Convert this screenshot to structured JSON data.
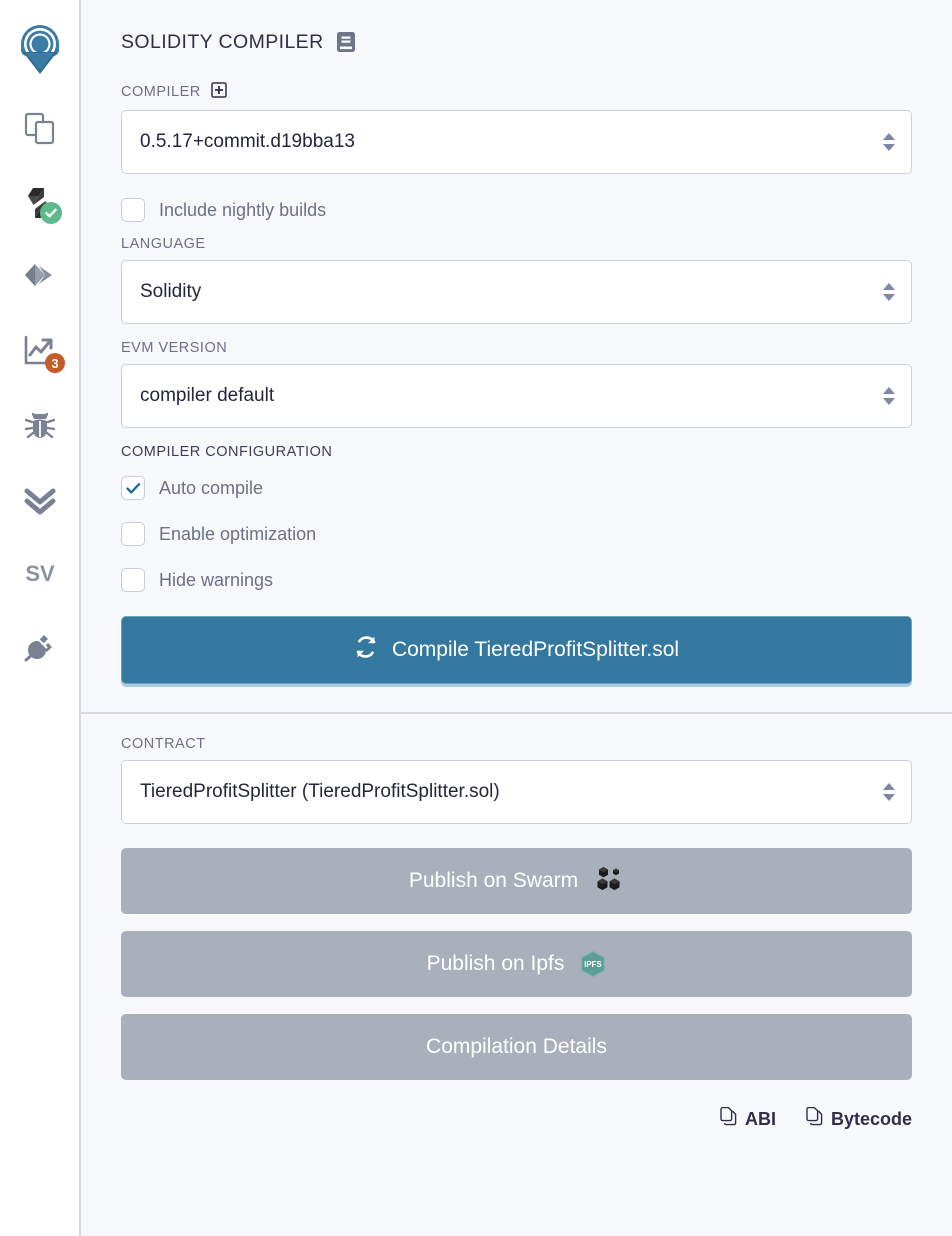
{
  "sidebar": {
    "logo_name": "remix-logo",
    "items": [
      {
        "name": "file-explorers-icon",
        "label": "File explorers"
      },
      {
        "name": "solidity-compiler-icon",
        "label": "Solidity compiler",
        "status": "compiled-ok"
      },
      {
        "name": "deploy-run-transactions-icon",
        "label": "Deploy & run transactions"
      },
      {
        "name": "analysis-icon",
        "label": "Solidity static analysis",
        "badge": "3"
      },
      {
        "name": "debugger-icon",
        "label": "Debugger"
      },
      {
        "name": "unit-testing-icon",
        "label": "Solidity unit testing"
      },
      {
        "name": "sourcify-icon",
        "label": "Sourcify"
      },
      {
        "name": "plugin-manager-icon",
        "label": "Plugin manager"
      }
    ]
  },
  "header": {
    "title": "SOLIDITY COMPILER",
    "doc_icon": "book-icon"
  },
  "compiler": {
    "label": "COMPILER",
    "add_icon": "plus-square-icon",
    "version": "0.5.17+commit.d19bba13",
    "nightly": {
      "label": "Include nightly builds",
      "checked": false
    }
  },
  "language": {
    "label": "LANGUAGE",
    "value": "Solidity"
  },
  "evm": {
    "label": "EVM VERSION",
    "value": "compiler default"
  },
  "configuration": {
    "label": "COMPILER CONFIGURATION",
    "options": [
      {
        "label": "Auto compile",
        "checked": true
      },
      {
        "label": "Enable optimization",
        "checked": false
      },
      {
        "label": "Hide warnings",
        "checked": false
      }
    ]
  },
  "compile_button": {
    "label": "Compile TieredProfitSplitter.sol",
    "icon": "sync-icon"
  },
  "contract": {
    "label": "CONTRACT",
    "value": "TieredProfitSplitter (TieredProfitSplitter.sol)"
  },
  "actions": [
    {
      "label": "Publish on Swarm",
      "icon": "swarm-cubes-icon"
    },
    {
      "label": "Publish on Ipfs",
      "icon": "ipfs-hex-icon"
    },
    {
      "label": "Compilation Details",
      "icon": ""
    }
  ],
  "footer_links": [
    {
      "label": "ABI",
      "icon": "copy-icon"
    },
    {
      "label": "Bytecode",
      "icon": "copy-icon"
    }
  ],
  "colors": {
    "accent_blue": "#34789f",
    "grey_button": "#a9afbb",
    "badge_orange": "#c35b26",
    "success_green": "#5cb98b",
    "panel_bg": "#f7f8fc",
    "ipfs_teal": "#569a94"
  }
}
